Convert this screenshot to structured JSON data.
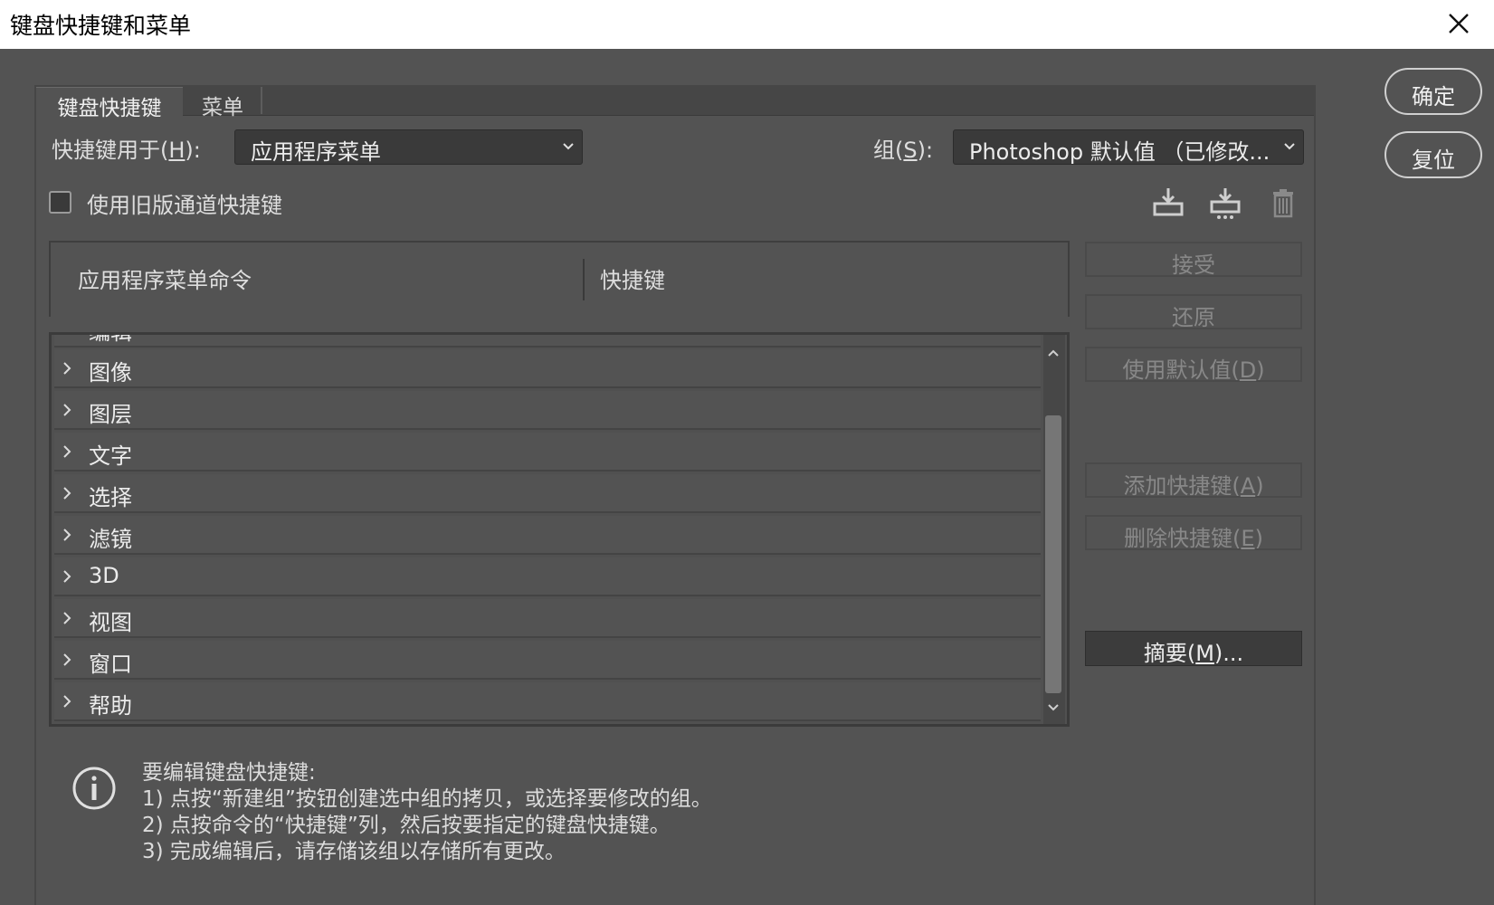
{
  "window": {
    "title": "键盘快捷键和菜单"
  },
  "tabs": [
    {
      "label": "键盘快捷键",
      "active": true
    },
    {
      "label": "菜单",
      "active": false
    }
  ],
  "shortcuts_for": {
    "label": "快捷键用于(",
    "mnemonic": "H",
    "label_end": "):",
    "value": "应用程序菜单"
  },
  "group": {
    "label": "组(",
    "mnemonic": "S",
    "label_end": "):",
    "value": "Photoshop 默认值 （已修改..."
  },
  "legacy_channel": {
    "label": "使用旧版通道快捷键",
    "checked": false
  },
  "toolbar_icons": [
    "save-set-icon",
    "save-as-set-icon",
    "delete-set-icon"
  ],
  "table": {
    "col_command": "应用程序菜单命令",
    "col_shortcut": "快捷键",
    "partial_row": "编辑",
    "rows": [
      "图像",
      "图层",
      "文字",
      "选择",
      "滤镜",
      "3D",
      "视图",
      "窗口",
      "帮助"
    ]
  },
  "side_buttons": {
    "accept": "接受",
    "undo": "还原",
    "use_default": {
      "label": "使用默认值(",
      "mnemonic": "D",
      "end": ")"
    },
    "add_shortcut": {
      "label": "添加快捷键(",
      "mnemonic": "A",
      "end": ")"
    },
    "delete_shortcut": {
      "label": "删除快捷键(",
      "mnemonic": "E",
      "end": ")"
    },
    "summary": {
      "label": "摘要(",
      "mnemonic": "M",
      "end": ")..."
    }
  },
  "dialog_buttons": {
    "ok": "确定",
    "reset": "复位"
  },
  "info": {
    "heading": "要编辑键盘快捷键:",
    "line1": "1) 点按“新建组”按钮创建选中组的拷贝，或选择要修改的组。",
    "line2": "2) 点按命令的“快捷键”列，然后按要指定的键盘快捷键。",
    "line3": "3) 完成编辑后，请存储该组以存储所有更改。"
  },
  "colors": {
    "panel_bg": "#535353",
    "titlebar_bg": "#ffffff",
    "field_bg": "#3a3a3a"
  }
}
